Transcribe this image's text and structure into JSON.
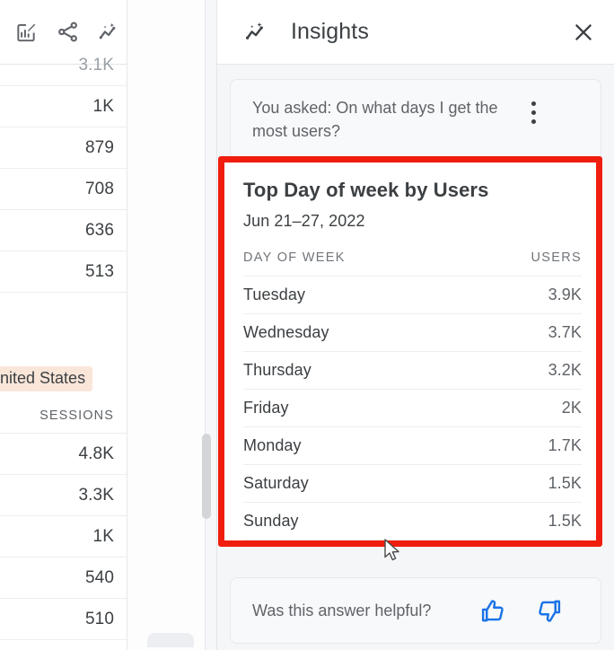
{
  "report": {
    "toolbar": {
      "icons": [
        {
          "name": "edit-chart-icon",
          "label": "Edit chart"
        },
        {
          "name": "share-icon",
          "label": "Share"
        },
        {
          "name": "insights-sparkle-icon",
          "label": "Insights"
        }
      ]
    },
    "top_metric_rows": [
      {
        "value": "3.1K",
        "clipped": true
      },
      {
        "value": "1K"
      },
      {
        "value": "879"
      },
      {
        "value": "708"
      },
      {
        "value": "636"
      },
      {
        "value": "513"
      }
    ],
    "highlight_chip": "nited States",
    "second_column_header": "SESSIONS",
    "second_metric_rows": [
      {
        "value": "4.8K"
      },
      {
        "value": "3.3K"
      },
      {
        "value": "1K"
      },
      {
        "value": "540"
      },
      {
        "value": "510"
      }
    ]
  },
  "insights": {
    "header": {
      "icon": "insights-sparkle-icon",
      "title": "Insights",
      "close_icon": "close-icon"
    },
    "question": {
      "text": "You asked: On what days I get the most users?",
      "menu_icon": "more-vert-icon"
    },
    "answer": {
      "title": "Top Day of week by Users",
      "date_range": "Jun 21–27, 2022"
    },
    "feedback": {
      "prompt": "Was this answer helpful?",
      "thumb_up_icon": "thumb-up-icon",
      "thumb_down_icon": "thumb-down-icon"
    }
  },
  "colors": {
    "annotation_red": "#f01d0e",
    "feedback_blue": "#1a73e8",
    "chip_peach": "#fae6d9"
  },
  "chart_data": {
    "type": "table",
    "title": "Top Day of week by Users",
    "subtitle": "Jun 21–27, 2022",
    "columns": [
      "DAY OF WEEK",
      "USERS"
    ],
    "categories": [
      "Tuesday",
      "Wednesday",
      "Thursday",
      "Friday",
      "Monday",
      "Saturday",
      "Sunday"
    ],
    "values": [
      3900,
      3700,
      3200,
      2000,
      1700,
      1500,
      1500
    ],
    "value_labels": [
      "3.9K",
      "3.7K",
      "3.2K",
      "2K",
      "1.7K",
      "1.5K",
      "1.5K"
    ],
    "xlabel": "Day of week",
    "ylabel": "Users",
    "rows": [
      {
        "day": "Tuesday",
        "users": "3.9K"
      },
      {
        "day": "Wednesday",
        "users": "3.7K"
      },
      {
        "day": "Thursday",
        "users": "3.2K"
      },
      {
        "day": "Friday",
        "users": "2K"
      },
      {
        "day": "Monday",
        "users": "1.7K"
      },
      {
        "day": "Saturday",
        "users": "1.5K"
      },
      {
        "day": "Sunday",
        "users": "1.5K"
      }
    ]
  }
}
